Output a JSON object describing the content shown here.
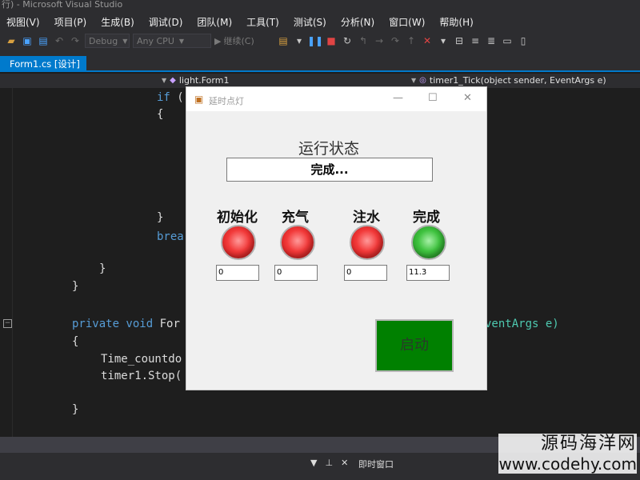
{
  "app": {
    "title": "行) - Microsoft Visual Studio",
    "accent": "#007acc",
    "background": "#1e1e1e"
  },
  "menu": {
    "items": [
      "视图(V)",
      "项目(P)",
      "生成(B)",
      "调试(D)",
      "团队(M)",
      "工具(T)",
      "测试(S)",
      "分析(N)",
      "窗口(W)",
      "帮助(H)"
    ]
  },
  "toolbar": {
    "config": "Debug",
    "platform": "Any CPU",
    "continue_label": "继续(C)"
  },
  "tabs": {
    "active": "Form1.cs [设计]"
  },
  "navbar": {
    "class_name": "light.Form1",
    "method_name": "timer1_Tick(object sender, EventArgs e)"
  },
  "code": {
    "lines": [
      {
        "kw": "if",
        "text": " ("
      },
      {
        "kw": "",
        "text": "{"
      },
      {
        "kw": "",
        "text": "}"
      },
      {
        "kw": "",
        "text": "brea"
      },
      {
        "kw": "",
        "text": "}"
      },
      {
        "kw": "",
        "text": "}"
      },
      {
        "kw": "private void",
        "text": " For"
      },
      {
        "kw": "",
        "text": "ventArgs e)"
      },
      {
        "kw": "",
        "text": "{"
      },
      {
        "kw": "",
        "text": "Time_countdo"
      },
      {
        "kw": "",
        "text": "timer1.Stop("
      },
      {
        "kw": "",
        "text": "}"
      }
    ]
  },
  "form": {
    "title": "延时点灯",
    "status_label": "运行状态",
    "status_value": "完成...",
    "stages": [
      {
        "label": "初始化",
        "lamp": "red",
        "value": "0"
      },
      {
        "label": "充气",
        "lamp": "red",
        "value": "0"
      },
      {
        "label": "注水",
        "lamp": "red",
        "value": "0"
      },
      {
        "label": "完成",
        "lamp": "green",
        "value": "11.3"
      }
    ],
    "start_button": "启动",
    "button_color": "#008000"
  },
  "bottom_panel": {
    "title": "即时窗口"
  },
  "watermark": {
    "line1": "源码海洋网",
    "line2": "www.codehy.com"
  }
}
